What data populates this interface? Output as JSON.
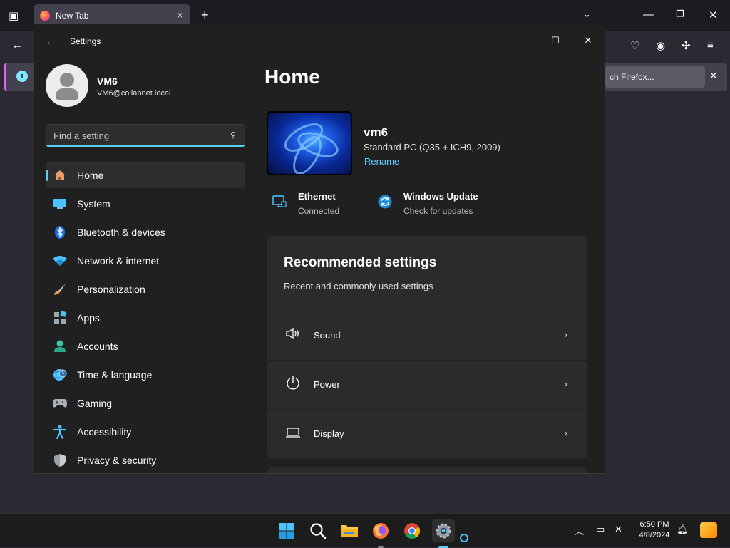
{
  "browser": {
    "tab_title": "New Tab",
    "tab_close": "✕",
    "new_tab": "+",
    "info_button": "ch Firefox...",
    "info_close": "✕"
  },
  "settings_window": {
    "title": "Settings",
    "profile": {
      "name": "VM6",
      "email": "VM6@collabnet.local"
    },
    "search": {
      "placeholder": "Find a setting"
    },
    "nav": [
      {
        "label": "Home",
        "icon": "home-icon",
        "active": true
      },
      {
        "label": "System",
        "icon": "system-icon"
      },
      {
        "label": "Bluetooth & devices",
        "icon": "bluetooth-icon"
      },
      {
        "label": "Network & internet",
        "icon": "wifi-icon"
      },
      {
        "label": "Personalization",
        "icon": "brush-icon"
      },
      {
        "label": "Apps",
        "icon": "apps-icon"
      },
      {
        "label": "Accounts",
        "icon": "accounts-icon"
      },
      {
        "label": "Time & language",
        "icon": "globe-clock-icon"
      },
      {
        "label": "Gaming",
        "icon": "gamepad-icon"
      },
      {
        "label": "Accessibility",
        "icon": "accessibility-icon"
      },
      {
        "label": "Privacy & security",
        "icon": "shield-icon"
      }
    ],
    "main": {
      "page_title": "Home",
      "device": {
        "name": "vm6",
        "spec": "Standard PC (Q35 + ICH9, 2009)",
        "rename": "Rename"
      },
      "status": [
        {
          "title": "Ethernet",
          "sub": "Connected",
          "icon": "ethernet-icon"
        },
        {
          "title": "Windows Update",
          "sub": "Check for updates",
          "icon": "windows-update-icon"
        }
      ],
      "recommended": {
        "title": "Recommended settings",
        "subtitle": "Recent and commonly used settings",
        "items": [
          {
            "label": "Sound",
            "icon": "speaker-icon"
          },
          {
            "label": "Power",
            "icon": "power-icon"
          },
          {
            "label": "Display",
            "icon": "display-icon"
          }
        ]
      }
    }
  },
  "taskbar": {
    "time": "6:50 PM",
    "date": "4/8/2024",
    "apps": [
      "start-icon",
      "search-icon",
      "file-explorer-icon",
      "firefox-icon",
      "chrome-icon",
      "settings-gear-icon"
    ]
  },
  "colors": {
    "accent": "#60cdff",
    "window_bg": "#202020",
    "card_bg": "#2b2b2b"
  }
}
